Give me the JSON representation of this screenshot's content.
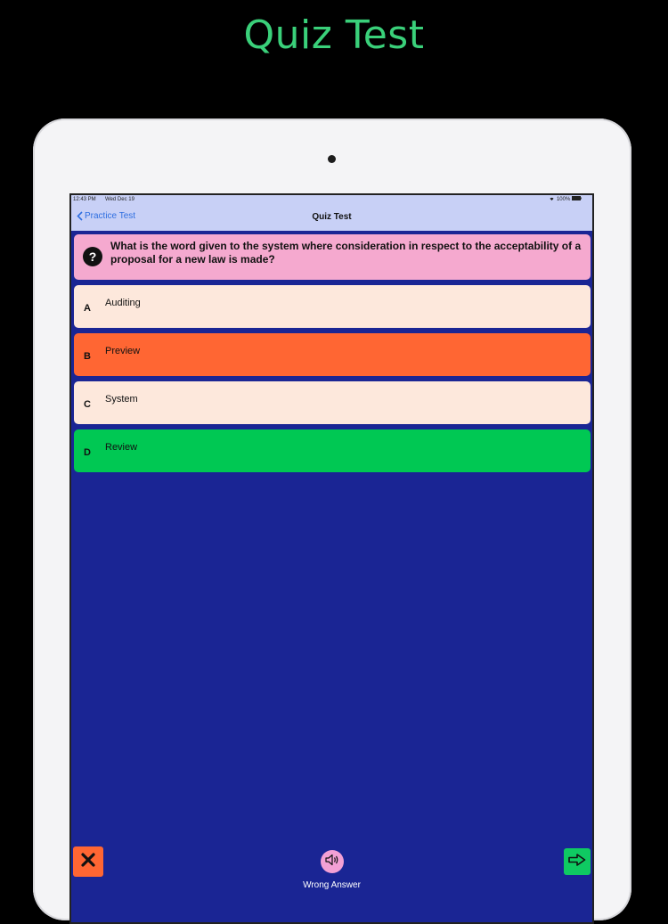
{
  "promo": {
    "title": "Quiz Test"
  },
  "status_bar": {
    "time": "12:43 PM",
    "date": "Wed Dec 19",
    "battery": "100%"
  },
  "nav": {
    "back_label": "Practice Test",
    "title": "Quiz Test"
  },
  "question": {
    "icon": "?",
    "text": "What is the word given to the system where consideration in respect to the acceptability of a proposal for a new law is made?"
  },
  "options": [
    {
      "letter": "A",
      "label": "Auditing",
      "color": "#fde8dc"
    },
    {
      "letter": "B",
      "label": "Preview",
      "color": "#ff6633"
    },
    {
      "letter": "C",
      "label": "System",
      "color": "#fde8dc"
    },
    {
      "letter": "D",
      "label": "Review",
      "color": "#00c853"
    }
  ],
  "footer": {
    "close_icon": "close-icon",
    "speaker_icon": "speaker-icon",
    "next_icon": "arrow-right-icon",
    "feedback": "Wrong Answer"
  },
  "colors": {
    "title": "#3ad07a",
    "screen_bg": "#1a2594",
    "nav_bg": "#c8d0f6",
    "question_bg": "#f5a9cf"
  }
}
